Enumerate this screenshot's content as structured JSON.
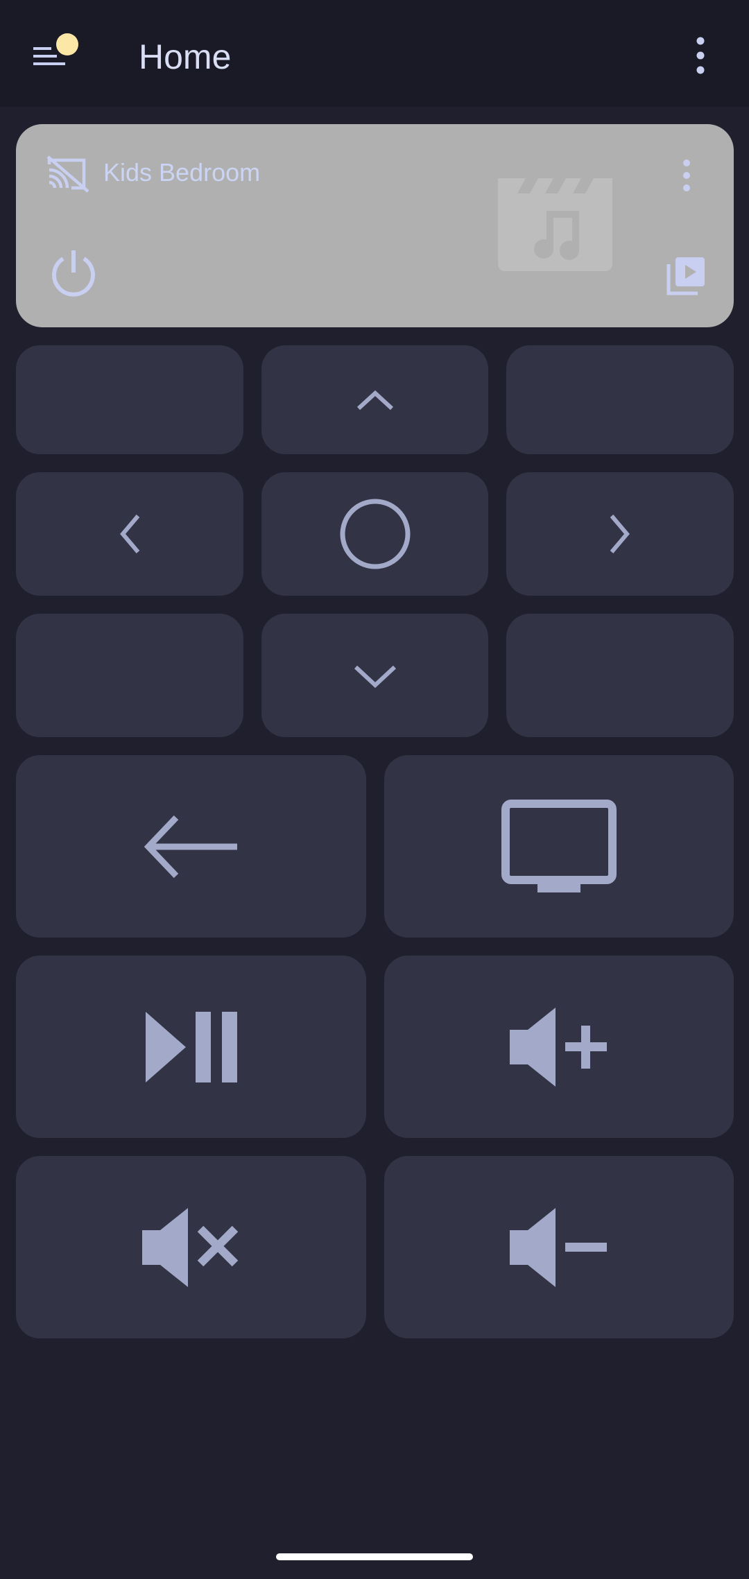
{
  "colors": {
    "background": "#1f1f2d",
    "app_bar": "#1a1a26",
    "card": "#b0b0b0",
    "button": "#323344",
    "icon": "#a3aac9",
    "accent_dot": "#fde7a6",
    "title_text": "#d9def4"
  },
  "header": {
    "title": "Home",
    "menu_icon": "menu-icon",
    "overflow_icon": "more-vert-icon"
  },
  "media_card": {
    "device_name": "Kids Bedroom",
    "cast_icon": "cast-disconnected-icon",
    "menu_icon": "more-vert-icon",
    "artwork_icon": "movie-music-icon",
    "power_icon": "power-icon",
    "playlist_icon": "playlist-play-icon"
  },
  "remote": {
    "dpad": [
      "",
      "arrow-up-icon",
      "",
      "arrow-left-icon",
      "select-circle-icon",
      "arrow-right-icon",
      "",
      "arrow-down-icon",
      ""
    ],
    "controls": [
      "back-arrow-icon",
      "tv-icon",
      "play-pause-icon",
      "volume-up-icon",
      "volume-mute-icon",
      "volume-down-icon"
    ]
  }
}
